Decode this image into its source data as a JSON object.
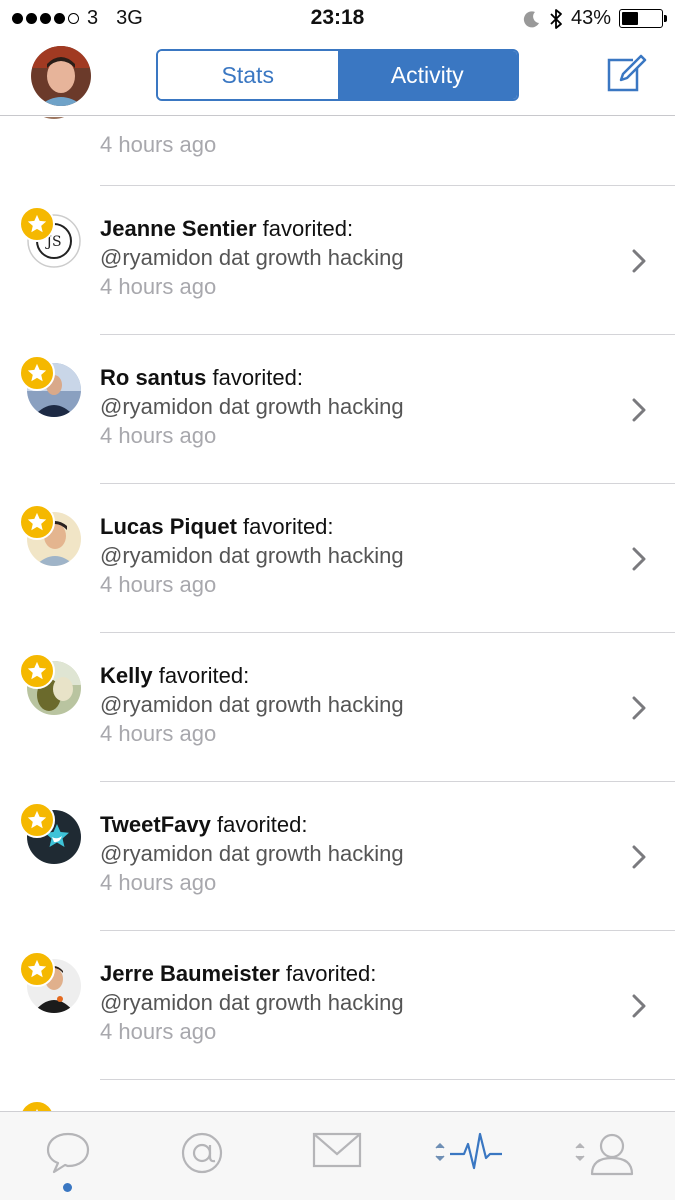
{
  "status_bar": {
    "carrier": "3",
    "network": "3G",
    "time": "23:18",
    "battery": "43%",
    "battery_level": 0.43
  },
  "nav": {
    "segments": [
      "Stats",
      "Activity"
    ],
    "active_segment": "Activity"
  },
  "activity": {
    "partial_time": "4 hours ago",
    "items": [
      {
        "name": "Jeanne Sentier",
        "action": " favorited:",
        "text": "@ryamidon dat growth hacking",
        "time": "4 hours ago"
      },
      {
        "name": "Ro santus",
        "action": " favorited:",
        "text": "@ryamidon dat growth hacking",
        "time": "4 hours ago"
      },
      {
        "name": "Lucas Piquet",
        "action": " favorited:",
        "text": "@ryamidon dat growth hacking",
        "time": "4 hours ago"
      },
      {
        "name": "Kelly",
        "action": " favorited:",
        "text": "@ryamidon dat growth hacking",
        "time": "4 hours ago"
      },
      {
        "name": "TweetFavy",
        "action": " favorited:",
        "text": "@ryamidon dat growth hacking",
        "time": "4 hours ago"
      },
      {
        "name": "Jerre Baumeister",
        "action": " favorited:",
        "text": "@ryamidon dat growth hacking",
        "time": "4 hours ago"
      }
    ]
  },
  "tab_bar": {
    "tabs": [
      "timeline-icon",
      "mentions-icon",
      "messages-icon",
      "activity-icon",
      "profile-icon"
    ],
    "active_tab": "activity-icon",
    "accent": "#3a77c2",
    "inactive": "#b5b5b8"
  },
  "colors": {
    "accent": "#3a77c2",
    "star": "#f5b800"
  }
}
